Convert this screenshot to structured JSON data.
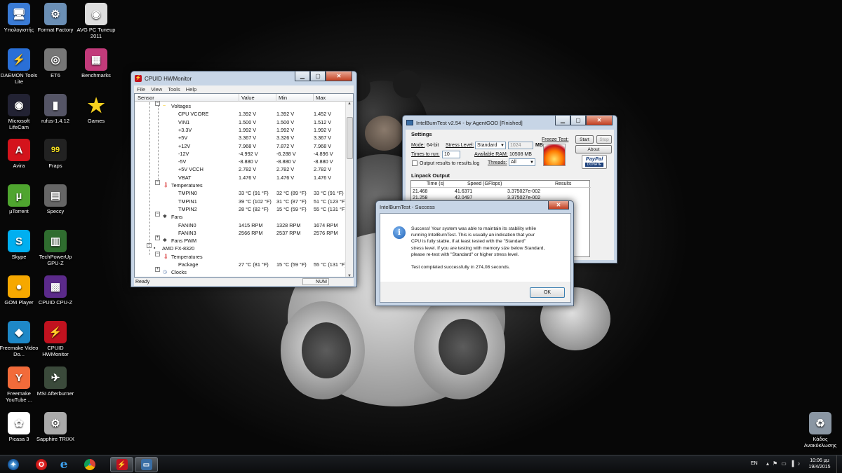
{
  "desktop_icons": [
    {
      "label": "Υπολογιστής",
      "icon": "computer-icon"
    },
    {
      "label": "Format Factory",
      "icon": "format-factory-icon"
    },
    {
      "label": "AVG PC Tuneup 2011",
      "icon": "avg-tuneup-icon"
    },
    {
      "label": "DAEMON Tools Lite",
      "icon": "daemon-tools-icon"
    },
    {
      "label": "ET6",
      "icon": "et6-icon"
    },
    {
      "label": "Benchmarks",
      "icon": "benchmarks-icon"
    },
    {
      "label": "Microsoft LifeCam",
      "icon": "lifecam-icon"
    },
    {
      "label": "rufus-1.4.12",
      "icon": "rufus-icon"
    },
    {
      "label": "Games",
      "icon": "games-star-icon"
    },
    {
      "label": "Avira",
      "icon": "avira-icon"
    },
    {
      "label": "Fraps",
      "icon": "fraps-icon"
    },
    {
      "label": "µTorrent",
      "icon": "utorrent-icon"
    },
    {
      "label": "Speccy",
      "icon": "speccy-icon"
    },
    {
      "label": "Skype",
      "icon": "skype-icon"
    },
    {
      "label": "TechPowerUp GPU-Z",
      "icon": "gpuz-icon"
    },
    {
      "label": "GOM Player",
      "icon": "gom-player-icon"
    },
    {
      "label": "CPUID CPU-Z",
      "icon": "cpuz-icon"
    },
    {
      "label": "Freemake Video Do...",
      "icon": "freemake-video-icon"
    },
    {
      "label": "CPUID HWMonitor",
      "icon": "hwmonitor-icon"
    },
    {
      "label": "Freemake YouTube ...",
      "icon": "freemake-youtube-icon"
    },
    {
      "label": "MSI Afterburner",
      "icon": "msi-afterburner-icon"
    },
    {
      "label": "Picasa 3",
      "icon": "picasa-icon"
    },
    {
      "label": "Sapphire TRIXX",
      "icon": "sapphire-trixx-icon"
    },
    {
      "label": "Κάδος Ανακύκλωσης",
      "icon": "recycle-bin-icon"
    }
  ],
  "hwmonitor": {
    "title": "CPUID HWMonitor",
    "menu": [
      "File",
      "View",
      "Tools",
      "Help"
    ],
    "columns": [
      "Sensor",
      "Value",
      "Min",
      "Max"
    ],
    "rows": [
      {
        "type": "group",
        "label": "Voltages",
        "icon": "voltage-icon"
      },
      {
        "type": "item",
        "label": "CPU VCORE",
        "value": "1.392 V",
        "min": "1.392 V",
        "max": "1.452 V"
      },
      {
        "type": "item",
        "label": "VIN1",
        "value": "1.500 V",
        "min": "1.500 V",
        "max": "1.512 V"
      },
      {
        "type": "item",
        "label": "+3.3V",
        "value": "1.992 V",
        "min": "1.992 V",
        "max": "1.992 V"
      },
      {
        "type": "item",
        "label": "+5V",
        "value": "3.367 V",
        "min": "3.326 V",
        "max": "3.367 V"
      },
      {
        "type": "item",
        "label": "+12V",
        "value": "7.968 V",
        "min": "7.872 V",
        "max": "7.968 V"
      },
      {
        "type": "item",
        "label": "-12V",
        "value": "-4.992 V",
        "min": "-6.288 V",
        "max": "-4.896 V"
      },
      {
        "type": "item",
        "label": "-5V",
        "value": "-8.880 V",
        "min": "-8.880 V",
        "max": "-8.880 V"
      },
      {
        "type": "item",
        "label": "+5V VCCH",
        "value": "2.782 V",
        "min": "2.782 V",
        "max": "2.782 V"
      },
      {
        "type": "item",
        "label": "VBAT",
        "value": "1.476 V",
        "min": "1.476 V",
        "max": "1.476 V"
      },
      {
        "type": "group",
        "label": "Temperatures",
        "icon": "thermometer-icon"
      },
      {
        "type": "item",
        "label": "TMPIN0",
        "value": "33 °C  (91 °F)",
        "min": "32 °C  (89 °F)",
        "max": "33 °C  (91 °F)"
      },
      {
        "type": "item",
        "label": "TMPIN1",
        "value": "39 °C  (102 °F)",
        "min": "31 °C  (87 °F)",
        "max": "51 °C  (123 °F)"
      },
      {
        "type": "item",
        "label": "TMPIN2",
        "value": "28 °C  (82 °F)",
        "min": "15 °C  (59 °F)",
        "max": "55 °C  (131 °F)"
      },
      {
        "type": "group",
        "label": "Fans",
        "icon": "fan-icon"
      },
      {
        "type": "item",
        "label": "FANIN0",
        "value": "1415 RPM",
        "min": "1328 RPM",
        "max": "1674 RPM"
      },
      {
        "type": "item",
        "label": "FANIN3",
        "value": "2566 RPM",
        "min": "2537 RPM",
        "max": "2576 RPM"
      },
      {
        "type": "group",
        "label": "Fans PWM",
        "icon": "fan-pwm-icon"
      },
      {
        "type": "device",
        "label": "AMD FX-8320",
        "icon": "cpu-chip-icon"
      },
      {
        "type": "group",
        "label": "Temperatures",
        "icon": "thermometer-icon"
      },
      {
        "type": "item",
        "label": "Package",
        "value": "27 °C  (81 °F)",
        "min": "15 °C  (59 °F)",
        "max": "55 °C  (131 °F)"
      },
      {
        "type": "group",
        "label": "Clocks",
        "icon": "clock-icon"
      }
    ],
    "status_left": "Ready",
    "status_right": "NUM"
  },
  "ibt": {
    "title": "IntelBurnTest v2.54 - by AgentGOD [Finished]",
    "settings_label": "Settings",
    "mode_label": "Mode:",
    "mode_value": "64-bit",
    "stress_label": "Stress Level:",
    "stress_value": "Standard",
    "mem_value": "1024",
    "mem_unit": "MB",
    "times_label": "Times to run:",
    "times_value": "10",
    "ram_label": "Available RAM:",
    "ram_value": "10508 MB",
    "output_label": "Output results to results.log",
    "threads_label": "Threads:",
    "threads_value": "All",
    "freeze_label": "Freeze Test:",
    "start_label": "Start",
    "stop_label": "Stop",
    "about_label": "About",
    "paypal_label": "PayPal",
    "donate_label": "DONATE",
    "linpack_label": "Linpack Output",
    "columns": [
      "Time (s)",
      "Speed (GFlops)",
      "Results"
    ],
    "results": [
      {
        "time": "21.468",
        "speed": "41.6371",
        "result": "3.375027e-002"
      },
      {
        "time": "21.258",
        "speed": "42.0497",
        "result": "3.375027e-002"
      }
    ]
  },
  "dialog": {
    "title": "IntelBurnTest - Success",
    "message_lines": [
      "Success! Your system was able to maintain its stability while",
      "running IntelBurnTest. This is usually an indication that your",
      "CPU is fully stable, if at least tested with the \"Standard\"",
      "stress level. If you are testing with memory size below Standard,",
      "please re-test with \"Standard\" or higher stress level."
    ],
    "completed": "Test completed successfully in 274,08 seconds.",
    "ok_label": "OK"
  },
  "taskbar": {
    "items": [
      {
        "icon": "start-orb-icon",
        "active": false
      },
      {
        "icon": "opera-icon",
        "active": false
      },
      {
        "icon": "internet-explorer-icon",
        "active": false
      },
      {
        "icon": "chrome-icon",
        "active": false
      },
      {
        "icon": "hwmonitor-icon",
        "active": true
      },
      {
        "icon": "intelburntest-icon",
        "active": true
      }
    ],
    "lang": "EN",
    "time": "10:06 μμ",
    "date": "19/4/2015"
  }
}
